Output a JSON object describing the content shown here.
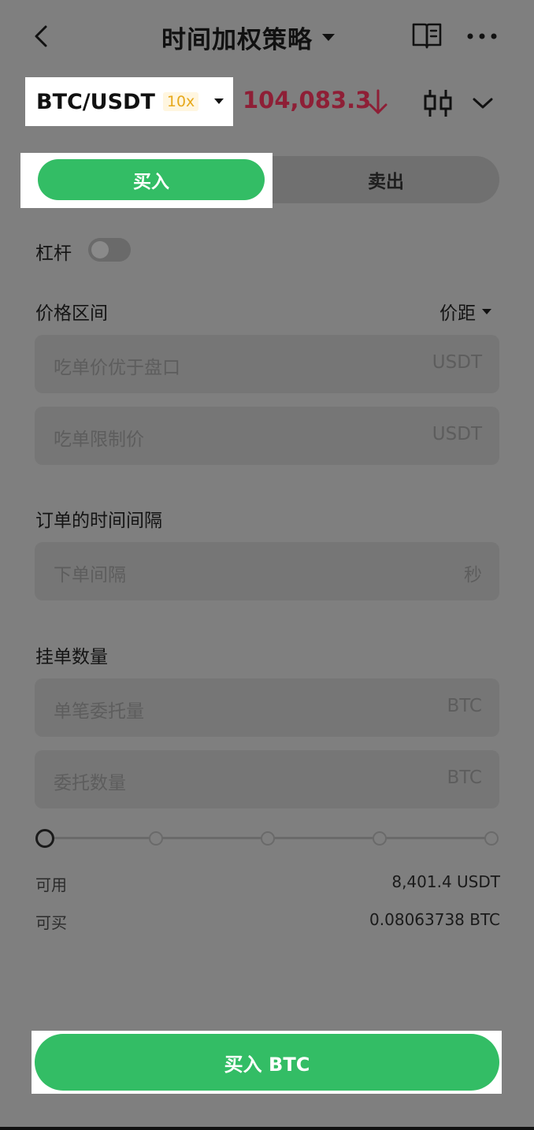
{
  "header": {
    "title": "时间加权策略",
    "icons": {
      "back": "back-chevron-icon",
      "book": "book-icon",
      "more": "more-dots-icon"
    }
  },
  "pair": {
    "name": "BTC/USDT",
    "leverage": "10x",
    "price": "104,083.3",
    "price_direction": "down",
    "colors": {
      "price": "#8e1f36",
      "leverage": "#e7a91c"
    }
  },
  "side_tabs": {
    "buy": "买入",
    "sell": "卖出",
    "selected": "buy"
  },
  "leverage_toggle": {
    "label": "杠杆",
    "enabled": false
  },
  "price_range": {
    "label": "价格区间",
    "mode": "价距",
    "fields": [
      {
        "placeholder": "吃单价优于盘口",
        "unit": "USDT",
        "value": ""
      },
      {
        "placeholder": "吃单限制价",
        "unit": "USDT",
        "value": ""
      }
    ]
  },
  "interval": {
    "label": "订单的时间间隔",
    "field": {
      "placeholder": "下单间隔",
      "unit": "秒",
      "value": ""
    }
  },
  "quantity": {
    "label": "挂单数量",
    "fields": [
      {
        "placeholder": "单笔委托量",
        "unit": "BTC",
        "value": ""
      },
      {
        "placeholder": "委托数量",
        "unit": "BTC",
        "value": ""
      }
    ],
    "slider_percent": 0
  },
  "balances": [
    {
      "label": "可用",
      "value": "8,401.4 USDT"
    },
    {
      "label": "可买",
      "value": "0.08063738 BTC"
    }
  ],
  "submit": {
    "label": "买入 BTC",
    "color": "#33bd65"
  }
}
